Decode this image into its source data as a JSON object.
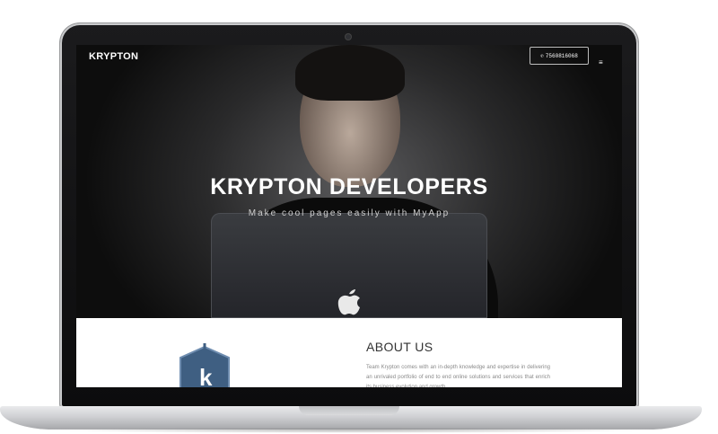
{
  "site": {
    "brand": "KRYPTON",
    "phone": "7560816068",
    "hero_title": "KRYPTON DEVELOPERS",
    "hero_subtitle": "Make cool pages easily with MyApp",
    "about_title": "ABOUT US",
    "about_text": "Team Krypton comes with an in-depth knowledge and expertise in delivering an unrivaled portfolio of end to end online solutions and services that enrich its business evolution and growth"
  },
  "icons": {
    "phone": "phone-icon",
    "menu": "hamburger-menu-icon",
    "logo": "krypton-k-shield-logo",
    "apple": "apple-logo-icon"
  },
  "colors": {
    "hero_bg": "#1c1c1c",
    "shield": "#3f5f82",
    "text_dark": "#333333",
    "text_muted": "#8a8a8a"
  }
}
